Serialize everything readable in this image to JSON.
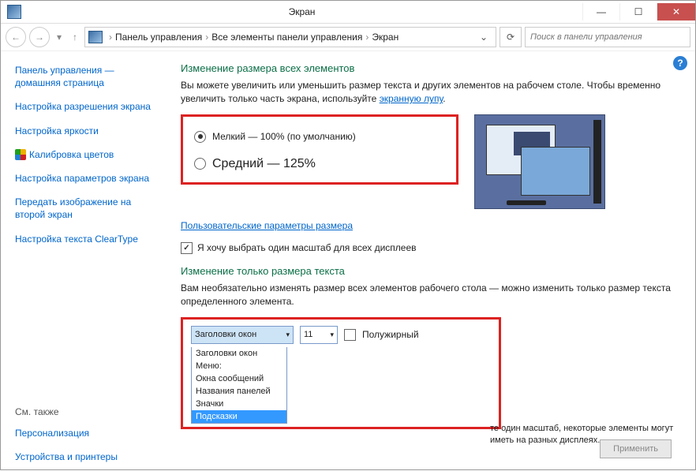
{
  "window": {
    "title": "Экран"
  },
  "breadcrumb": {
    "root": "Панель управления",
    "all": "Все элементы панели управления",
    "leaf": "Экран"
  },
  "search": {
    "placeholder": "Поиск в панели управления"
  },
  "sidebar": {
    "home1": "Панель управления —",
    "home2": "домашняя страница",
    "resolution": "Настройка разрешения экрана",
    "brightness": "Настройка яркости",
    "calibrate": "Калибровка цветов",
    "params": "Настройка параметров экрана",
    "project": "Передать изображение на второй экран",
    "cleartype": "Настройка текста ClearType",
    "seealso": "См. также",
    "personalization": "Персонализация",
    "devices": "Устройства и принтеры"
  },
  "main": {
    "h1": "Изменение размера всех элементов",
    "p1a": "Вы можете увеличить или уменьшить размер текста и других элементов на рабочем столе. Чтобы временно увеличить только часть экрана, используйте ",
    "p1link": "экранную лупу",
    "p1b": ".",
    "radio_small": "Мелкий — 100% (по умолчанию)",
    "radio_medium": "Средний — 125%",
    "custom_link": "Пользовательские параметры размера",
    "checkbox": "Я хочу выбрать один масштаб для всех дисплеев",
    "h2": "Изменение только размера текста",
    "p2": "Вам необязательно изменять размер всех элементов рабочего стола — можно изменить только размер текста определенного элемента.",
    "select_value": "Заголовки окон",
    "fontsize": "11",
    "bold": "Полужирный",
    "options": [
      "Заголовки окон",
      "Меню:",
      "Окна сообщений",
      "Названия панелей",
      "Значки",
      "Подсказки"
    ],
    "note": "те один масштаб, некоторые элементы могут иметь на разных дисплеях.",
    "apply": "Применить"
  }
}
